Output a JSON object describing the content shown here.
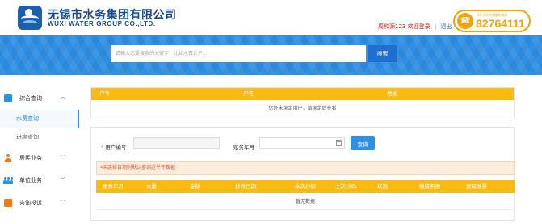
{
  "header": {
    "brand_cn": "无锡市水务集团有限公司",
    "brand_en": "WUXI WATER GROUP CO.,LTD.",
    "user": "周和源123",
    "welcome": "欢迎登录",
    "separator": "|",
    "logout": "退出",
    "hotline_tagline": "24小时供水服务热线",
    "hotline_number": "82764111",
    "phone_icon": "phone-icon"
  },
  "search": {
    "placeholder": "请输入您要搜索的关键字，比如水费计户...",
    "button_label": "搜索"
  },
  "sidebar": {
    "items": [
      {
        "label": "综合查询",
        "icon": "grid-icon",
        "expanded": true,
        "children": [
          {
            "label": "水费查询",
            "active": true
          },
          {
            "label": "进度查询",
            "active": false
          }
        ]
      },
      {
        "label": "居民业务",
        "icon": "user-icon",
        "expanded": false
      },
      {
        "label": "单位业务",
        "icon": "group-icon",
        "expanded": false
      },
      {
        "label": "咨询投诉",
        "icon": "book-icon",
        "expanded": false
      }
    ]
  },
  "account_table": {
    "columns": [
      "户号",
      "户名",
      "地址"
    ],
    "empty_message": "您还未绑定用户，请绑定后查看"
  },
  "query_form": {
    "account_label": "用户编号",
    "required_mark": "*",
    "account_value": "",
    "month_label": "账务年月",
    "month_value": "",
    "query_button": "查询"
  },
  "notice": "*未选择日期则默认查询近半年数据",
  "bill_table": {
    "columns": [
      "账务年月",
      "水量",
      "金额",
      "抄表日期",
      "本次抄码",
      "上次抄码",
      "状态",
      "缴费明细",
      "获取发票"
    ],
    "empty_message": "暂无数据"
  },
  "colors": {
    "brand_blue": "#1b4a8c",
    "banner_blue": "#2e8fe5",
    "table_header_yellow": "#f9bb11",
    "hotline_orange": "#f5a300"
  }
}
